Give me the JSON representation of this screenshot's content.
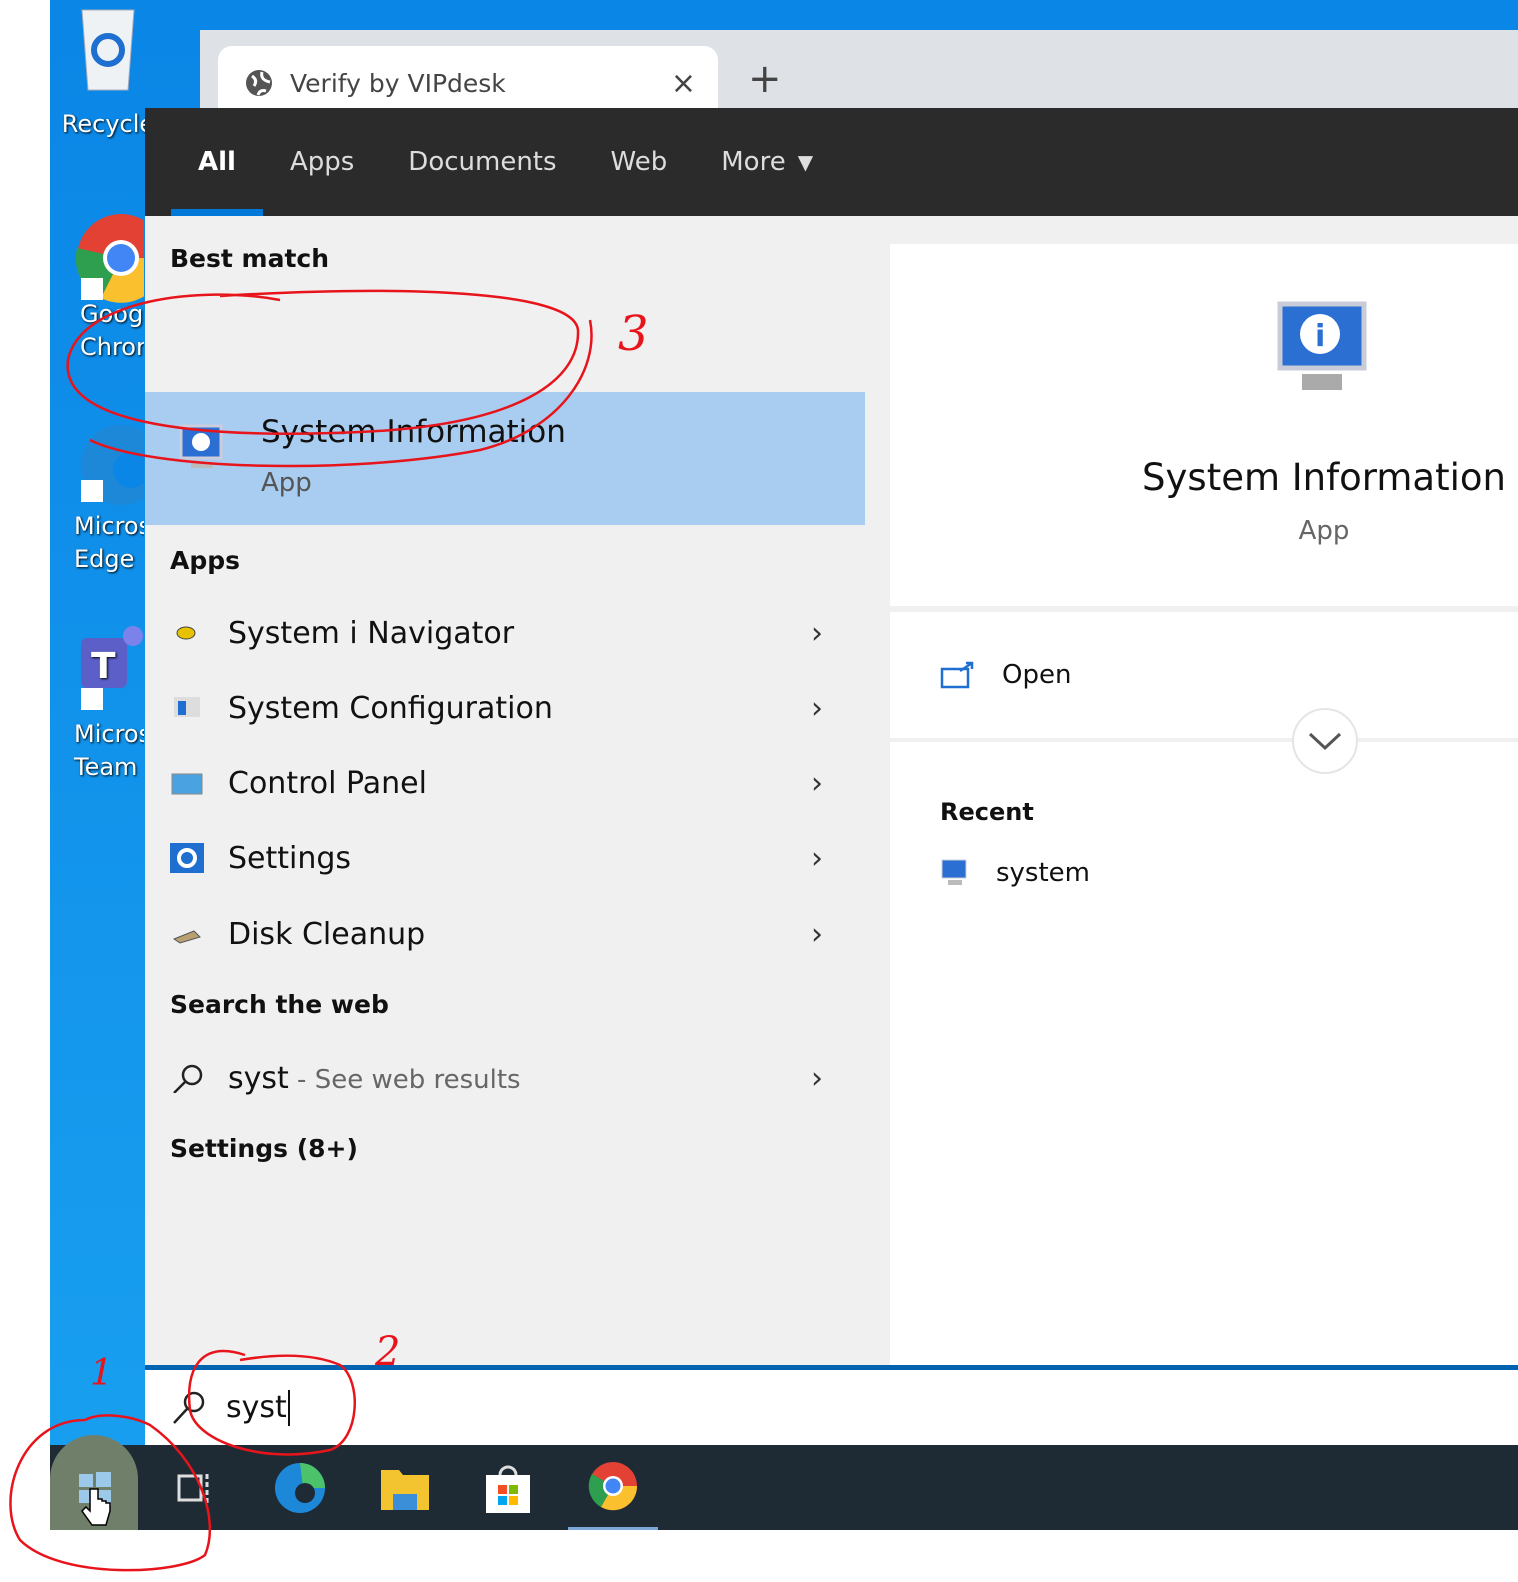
{
  "desktop": {
    "icons": [
      {
        "name": "recycle-bin",
        "label": "Recycle"
      },
      {
        "name": "google-chrome",
        "label": "Goog Chron"
      },
      {
        "name": "microsoft-edge",
        "label": "Micros Edge"
      },
      {
        "name": "microsoft-teams",
        "label": "Micros Team"
      }
    ]
  },
  "browser": {
    "tab_title": "Verify by VIPdesk",
    "close": "×",
    "new_tab": "+"
  },
  "search_panel": {
    "tabs": [
      {
        "label": "All",
        "active": true
      },
      {
        "label": "Apps"
      },
      {
        "label": "Documents"
      },
      {
        "label": "Web"
      },
      {
        "label": "More"
      }
    ],
    "best_match_header": "Best match",
    "best_match": {
      "name": "System Information",
      "type": "App"
    },
    "apps_header": "Apps",
    "apps": [
      {
        "label": "System i Navigator",
        "icon": "navigator-icon"
      },
      {
        "label": "System Configuration",
        "icon": "msconfig-icon"
      },
      {
        "label": "Control Panel",
        "icon": "control-panel-icon"
      },
      {
        "label": "Settings",
        "icon": "gear-icon"
      },
      {
        "label": "Disk Cleanup",
        "icon": "disk-cleanup-icon"
      }
    ],
    "web_header": "Search the web",
    "web_query": "syst",
    "web_suffix": " - See web results",
    "settings_header": "Settings (8+)",
    "preview": {
      "name": "System Information",
      "type": "App",
      "open_label": "Open",
      "recent_header": "Recent",
      "recent_items": [
        "system"
      ]
    },
    "query": "syst"
  },
  "annotations": {
    "color": "#e8141b",
    "labels": [
      "1",
      "2",
      "3"
    ]
  },
  "colors": {
    "accent": "#0078d7",
    "highlight": "#a9cdf0",
    "desktop": "#0a86e6",
    "taskbar": "#1e2b35"
  }
}
